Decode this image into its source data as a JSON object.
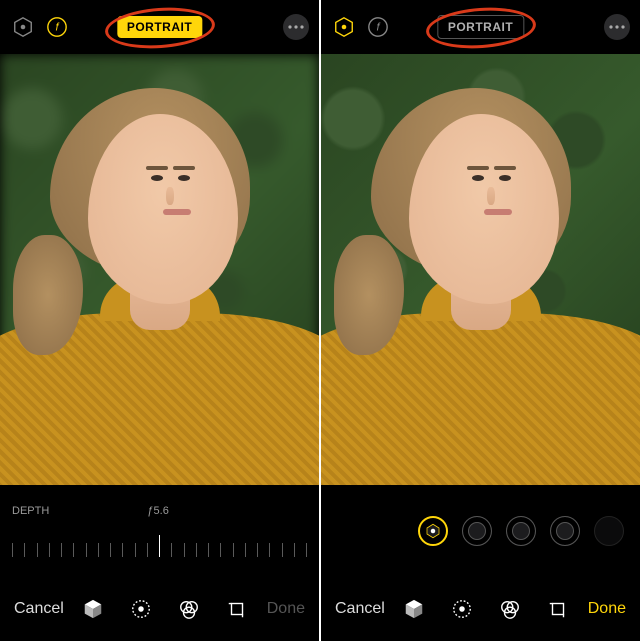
{
  "colors": {
    "accent": "#ffd60a",
    "annotation": "#d93a1a",
    "bg": "#000"
  },
  "left": {
    "top": {
      "mode_label": "PORTRAIT",
      "mode_active": true
    },
    "depth": {
      "label": "DEPTH",
      "value": "ƒ5.6"
    },
    "bottom": {
      "cancel": "Cancel",
      "done": "Done",
      "done_active": false,
      "tools": [
        "lighting-cube",
        "adjust-dial",
        "filters-circles",
        "crop-rotate"
      ]
    }
  },
  "right": {
    "top": {
      "mode_label": "PORTRAIT",
      "mode_active": false
    },
    "lighting_options": [
      "natural-light",
      "studio-light",
      "contour-light",
      "stage-light",
      "stage-light-mono"
    ],
    "lighting_selected_index": 0,
    "bottom": {
      "cancel": "Cancel",
      "done": "Done",
      "done_active": true,
      "tools": [
        "lighting-cube",
        "adjust-dial",
        "filters-circles",
        "crop-rotate"
      ]
    }
  }
}
